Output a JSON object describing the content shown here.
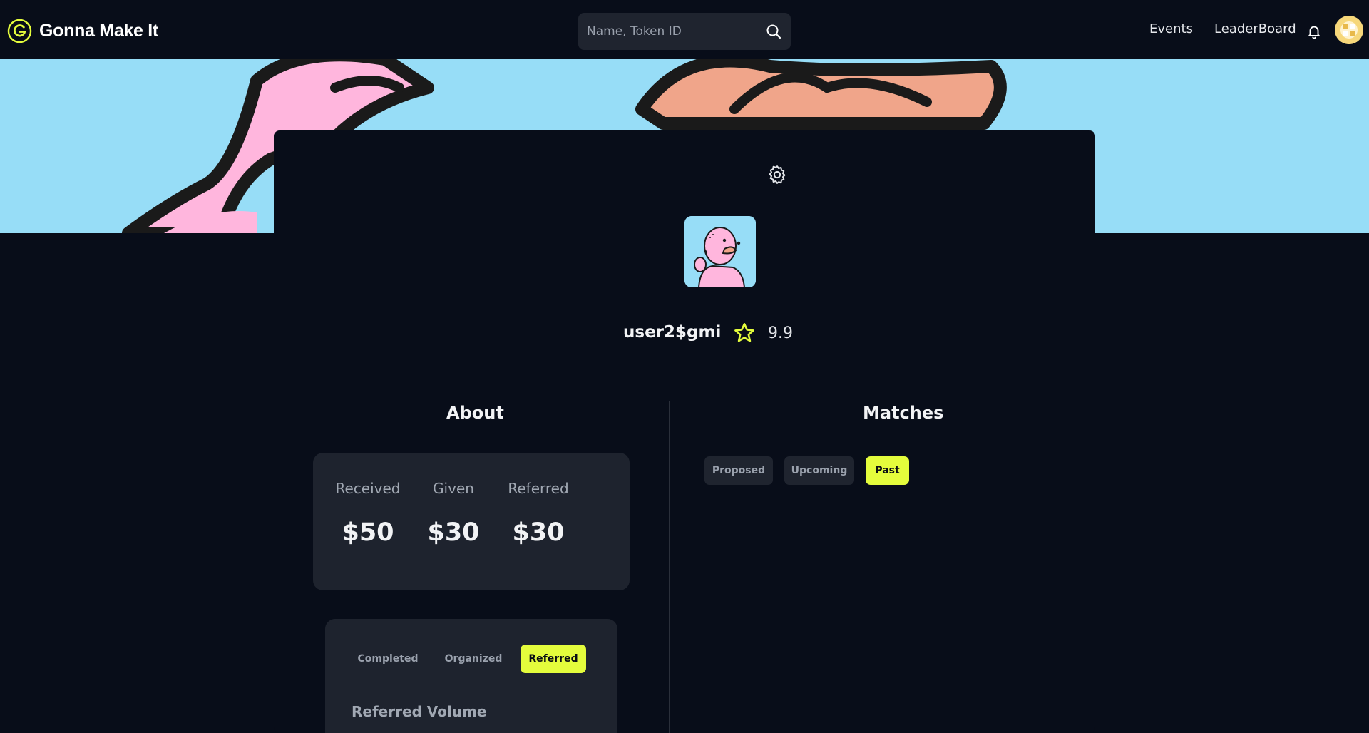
{
  "app": {
    "name": "Gonna Make It"
  },
  "search": {
    "placeholder": "Name, Token ID"
  },
  "nav": {
    "events": "Events",
    "leaderboard": "LeaderBoard"
  },
  "profile": {
    "username": "user2$gmi",
    "rating": "9.9"
  },
  "about": {
    "title": "About",
    "stats": [
      {
        "label": "Received",
        "value": "$50"
      },
      {
        "label": "Given",
        "value": "$30"
      },
      {
        "label": "Referred",
        "value": "$30"
      }
    ],
    "tabs": [
      "Completed",
      "Organized",
      "Referred"
    ],
    "active_tab": "Referred",
    "volume_title": "Referred Volume"
  },
  "matches": {
    "title": "Matches",
    "filters": [
      "Proposed",
      "Upcoming",
      "Past"
    ],
    "active_filter": "Past"
  },
  "colors": {
    "accent": "#e4fc3c",
    "background": "#080d19",
    "card": "#1e232e",
    "banner_sky": "#97ddf7",
    "character_pink": "#ffb6dd"
  },
  "icons": [
    "brand-logo-icon",
    "search-icon",
    "bell-icon",
    "gear-icon",
    "star-icon"
  ]
}
